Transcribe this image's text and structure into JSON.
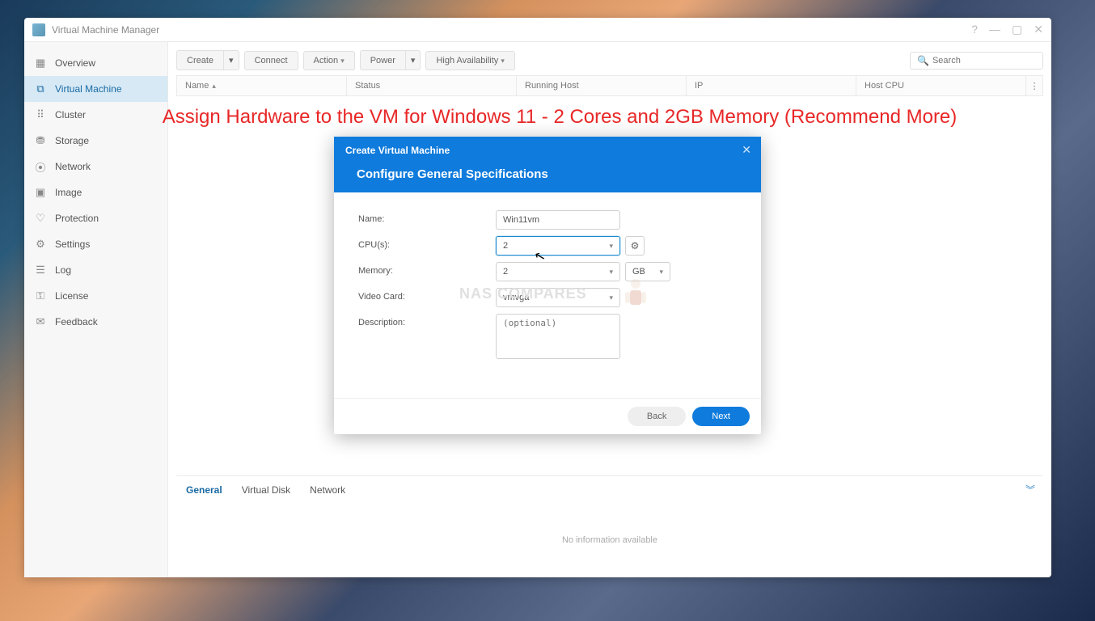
{
  "app": {
    "title": "Virtual Machine Manager"
  },
  "annotation": "Assign Hardware to the VM for Windows 11 -  2 Cores and 2GB Memory (Recommend More)",
  "watermark": "NAS COMPARES",
  "sidebar": {
    "items": [
      {
        "label": "Overview",
        "icon": "▦"
      },
      {
        "label": "Virtual Machine",
        "icon": "⧉"
      },
      {
        "label": "Cluster",
        "icon": "⠿"
      },
      {
        "label": "Storage",
        "icon": "⛃"
      },
      {
        "label": "Network",
        "icon": "⦿"
      },
      {
        "label": "Image",
        "icon": "▣"
      },
      {
        "label": "Protection",
        "icon": "♡"
      },
      {
        "label": "Settings",
        "icon": "⚙"
      },
      {
        "label": "Log",
        "icon": "☰"
      },
      {
        "label": "License",
        "icon": "⚿"
      },
      {
        "label": "Feedback",
        "icon": "✉"
      }
    ]
  },
  "toolbar": {
    "create": "Create",
    "connect": "Connect",
    "action": "Action",
    "power": "Power",
    "ha": "High Availability",
    "search_placeholder": "Search"
  },
  "table": {
    "columns": {
      "name": "Name",
      "status": "Status",
      "host": "Running Host",
      "ip": "IP",
      "hostcpu": "Host CPU"
    }
  },
  "bottom_tabs": {
    "general": "General",
    "vdisk": "Virtual Disk",
    "network": "Network"
  },
  "no_info": "No information available",
  "modal": {
    "title_sm": "Create Virtual Machine",
    "title_lg": "Configure General Specifications",
    "labels": {
      "name": "Name:",
      "cpu": "CPU(s):",
      "memory": "Memory:",
      "video": "Video Card:",
      "description": "Description:"
    },
    "values": {
      "name": "Win11vm",
      "cpu": "2",
      "memory": "2",
      "memory_unit": "GB",
      "video": "vmvga",
      "description_placeholder": "(optional)"
    },
    "buttons": {
      "back": "Back",
      "next": "Next"
    }
  }
}
